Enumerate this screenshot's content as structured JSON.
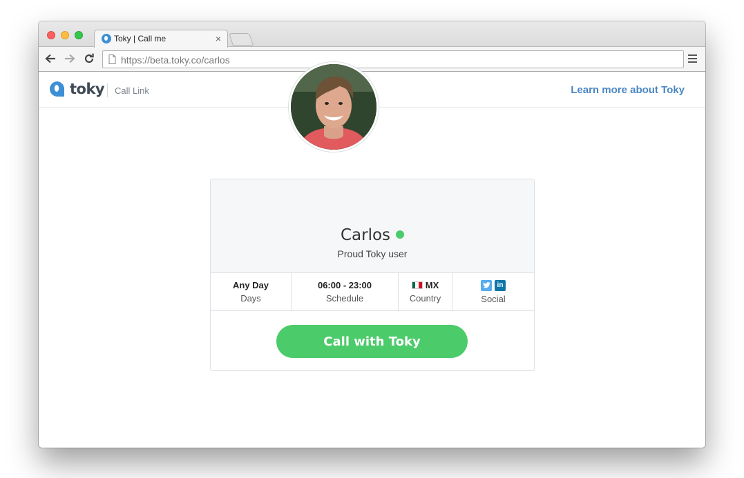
{
  "browser": {
    "tab_title": "Toky | Call me",
    "tab_close": "×",
    "url_host": "https://beta.toky.co",
    "url_path": "/carlos"
  },
  "site": {
    "logo_text": "toky",
    "header_sub": "Call Link",
    "learn_more": "Learn more about Toky",
    "brand_color": "#3d8fd6",
    "link_color": "#4a86c5"
  },
  "profile": {
    "name": "Carlos",
    "status_color": "#4ccb6b",
    "tagline": "Proud Toky user"
  },
  "info": {
    "days_value": "Any Day",
    "days_label": "Days",
    "schedule_value": "06:00 - 23:00",
    "schedule_label": "Schedule",
    "country_value": "MX",
    "country_label": "Country",
    "social_label": "Social",
    "social_twitter_icon": "twitter-icon",
    "social_linkedin_icon": "linkedin-icon",
    "linkedin_glyph": "in"
  },
  "call": {
    "label": "Call with Toky",
    "color": "#4ccb6b"
  }
}
